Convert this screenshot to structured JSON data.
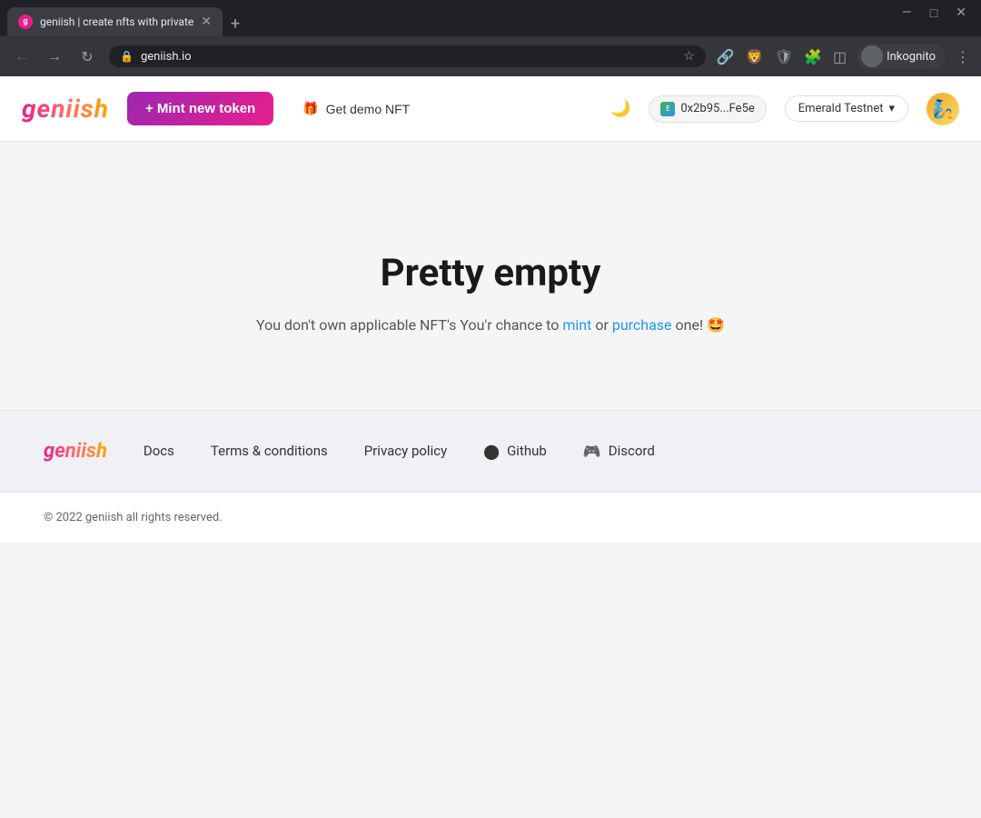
{
  "browser": {
    "tab_title": "geniish | create nfts with private",
    "url": "geniish.io",
    "profile_name": "Inkognito"
  },
  "header": {
    "logo": "geniish",
    "mint_button": "+ Mint new token",
    "get_demo": "Get demo NFT",
    "wallet_address": "0x2b95...Fe5e",
    "network": "Emerald Testnet",
    "network_chevron": "▾"
  },
  "main": {
    "empty_title": "Pretty empty",
    "empty_desc_prefix": "You don't own applicable NFT's You'r chance to ",
    "empty_desc_link1": "mint",
    "empty_desc_middle": " or ",
    "empty_desc_link2": "purchase",
    "empty_desc_suffix": " one! 🤩"
  },
  "footer": {
    "logo": "geniish",
    "links": [
      {
        "label": "Docs"
      },
      {
        "label": "Terms & conditions"
      },
      {
        "label": "Privacy policy"
      },
      {
        "label": "Github"
      },
      {
        "label": "Discord"
      }
    ]
  },
  "copyright": "© 2022 geniish all rights reserved."
}
